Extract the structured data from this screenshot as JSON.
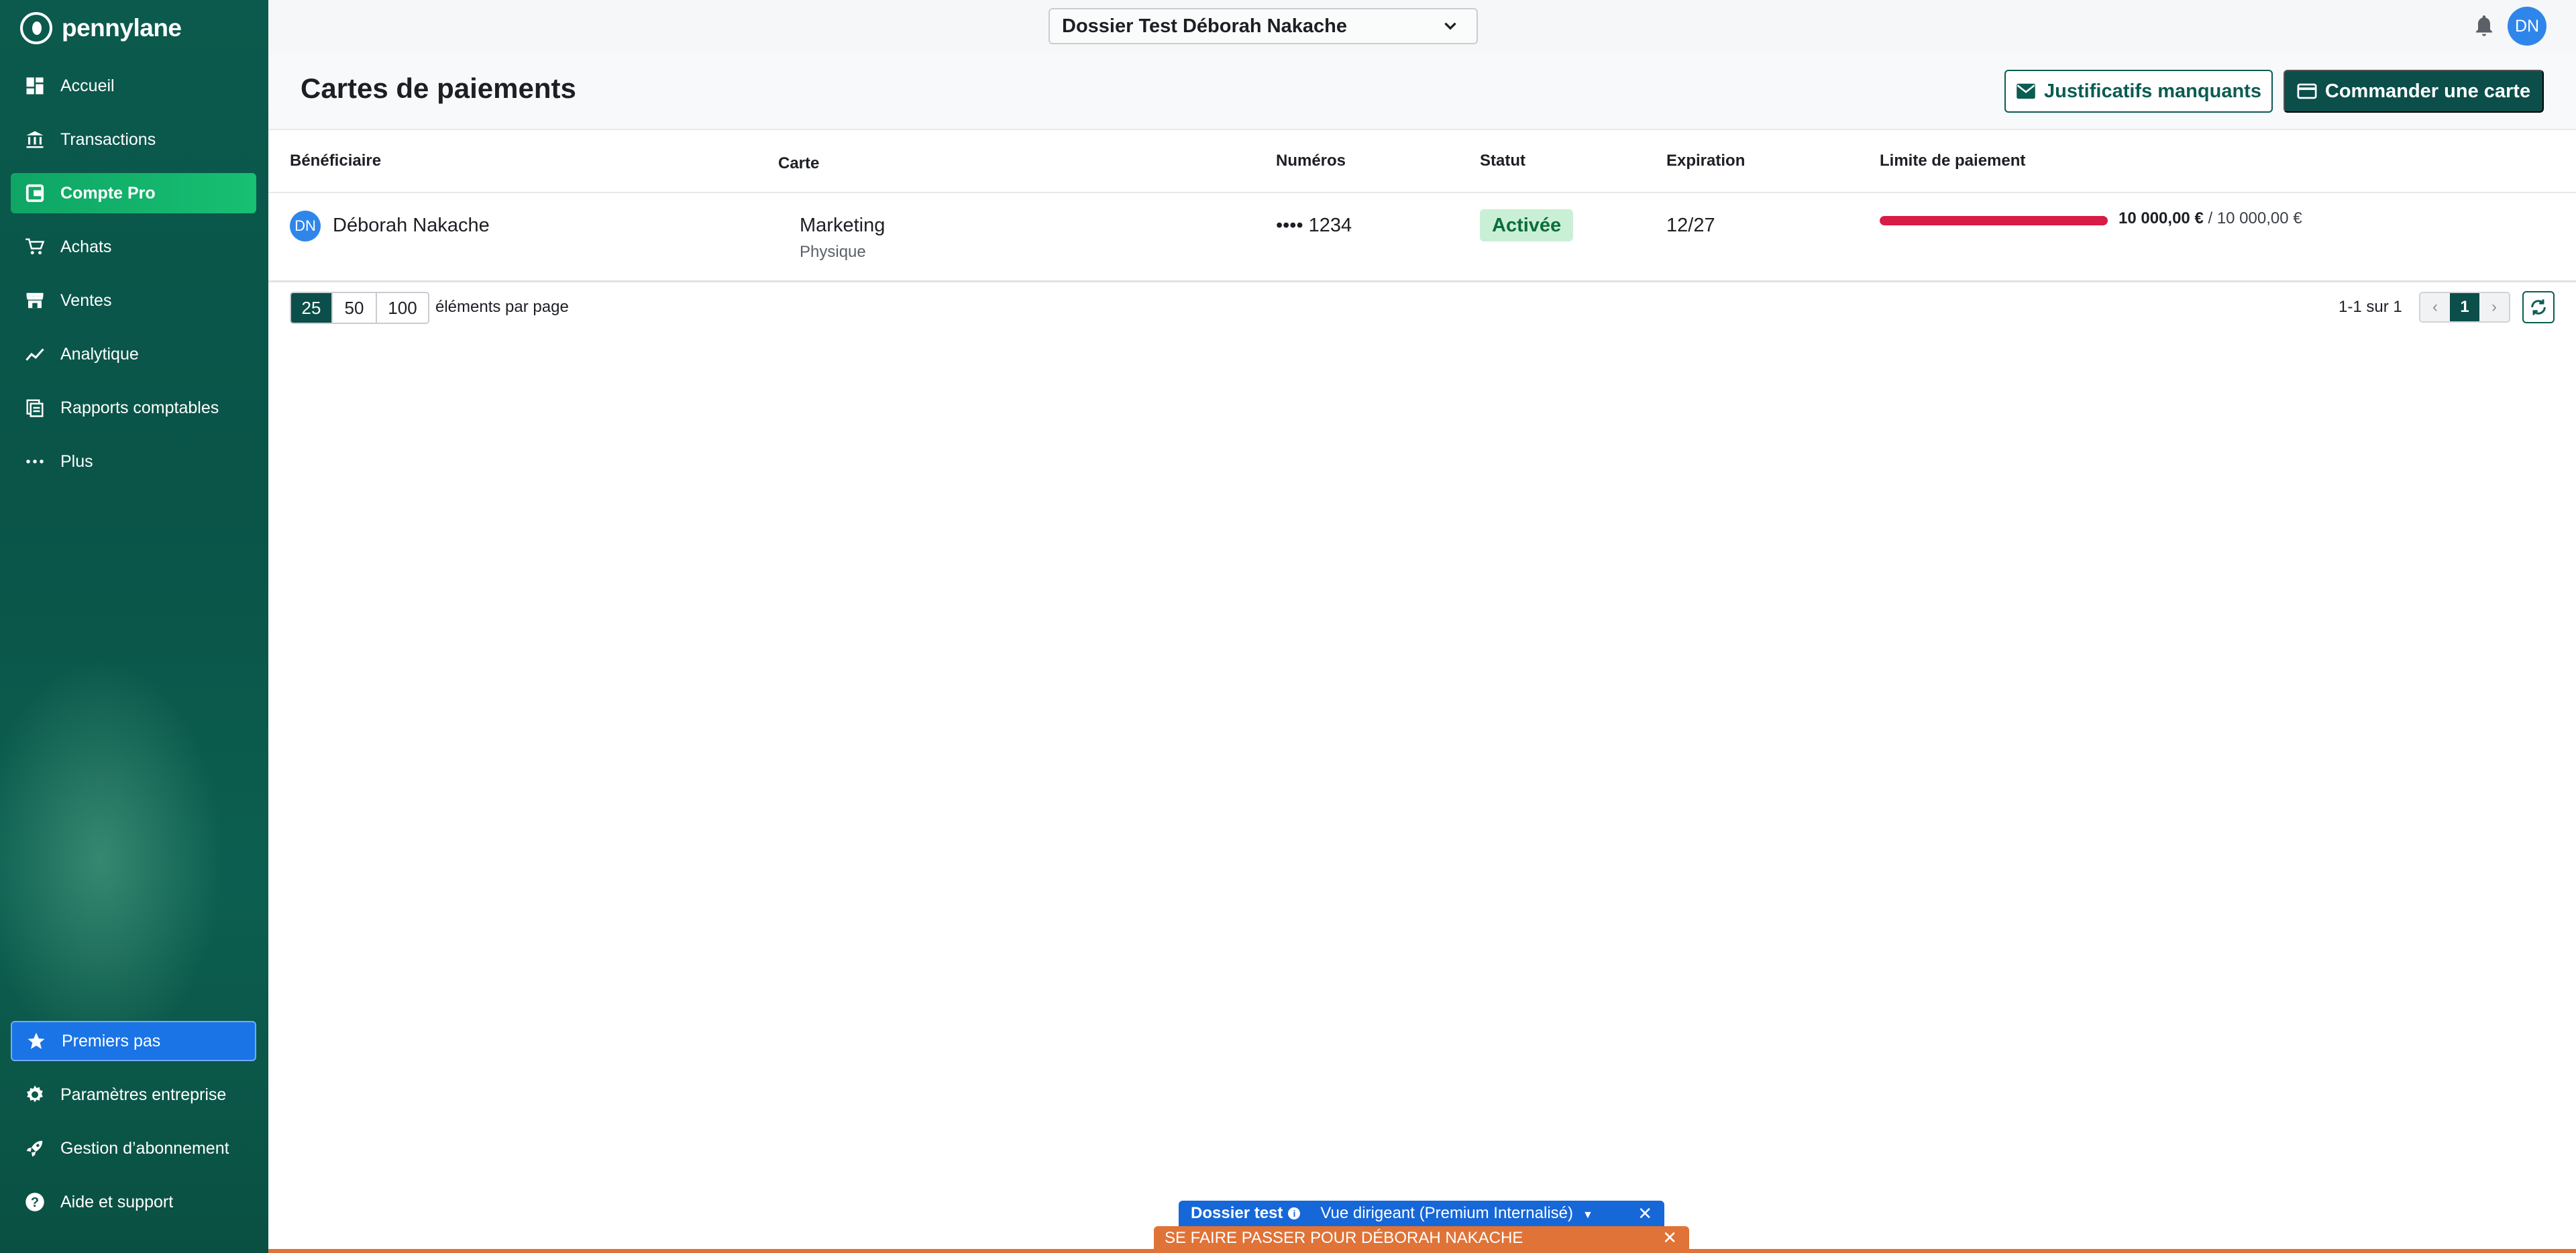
{
  "sidebar": {
    "logo": "pennylane",
    "items": [
      {
        "label": "Accueil",
        "icon": "dashboard-icon"
      },
      {
        "label": "Transactions",
        "icon": "bank-icon"
      },
      {
        "label": "Compte Pro",
        "icon": "wallet-icon",
        "active": true
      },
      {
        "label": "Achats",
        "icon": "cart-icon"
      },
      {
        "label": "Ventes",
        "icon": "store-icon"
      },
      {
        "label": "Analytique",
        "icon": "chart-line-icon"
      },
      {
        "label": "Rapports comptables",
        "icon": "report-icon"
      },
      {
        "label": "Plus",
        "icon": "more-dots-icon"
      }
    ],
    "bottom_items": [
      {
        "label": "Premiers pas",
        "icon": "star-icon"
      },
      {
        "label": "Paramètres entreprise",
        "icon": "gear-icon"
      },
      {
        "label": "Gestion d’abonnement",
        "icon": "rocket-icon"
      },
      {
        "label": "Aide et support",
        "icon": "help-icon"
      }
    ]
  },
  "topbar": {
    "dossier_select": "Dossier Test Déborah Nakache",
    "avatar_initials": "DN"
  },
  "page": {
    "title": "Cartes de paiements",
    "btn_missing_docs": "Justificatifs manquants",
    "btn_order_card": "Commander une carte"
  },
  "table": {
    "headers": {
      "beneficiaire": "Bénéficiaire",
      "carte": "Carte",
      "numeros": "Numéros",
      "statut": "Statut",
      "expiration": "Expiration",
      "limite": "Limite de paiement"
    },
    "rows": [
      {
        "avatar": "DN",
        "beneficiaire": "Déborah Nakache",
        "carte": "Marketing",
        "type": "Physique",
        "numero": "•••• 1234",
        "statut": "Activée",
        "expiration": "12/27",
        "limite_used": "10 000,00 €",
        "limite_sep": " / ",
        "limite_total": "10 000,00 €",
        "limite_ratio": 1.0
      }
    ]
  },
  "pagination": {
    "sizes": [
      "25",
      "50",
      "100"
    ],
    "selected_size": "25",
    "per_page_label": "éléments par page",
    "range": "1-1 sur 1",
    "prev": "‹",
    "current_page": "1",
    "next": "›"
  },
  "banners": {
    "dossier_label": "Dossier test",
    "view_label": "Vue dirigeant (Premium Internalisé)",
    "impersonate": "SE FAIRE PASSER POUR DÉBORAH NAKACHE",
    "close": "✕"
  },
  "colors": {
    "sidebar": "#0b5a4d",
    "accent": "#0b4e4a",
    "active_nav": "#17c072",
    "status_bg": "#c9f0d6",
    "limit_fill": "#d81b47",
    "banner_blue": "#1667d8",
    "banner_orange": "#e07337"
  }
}
